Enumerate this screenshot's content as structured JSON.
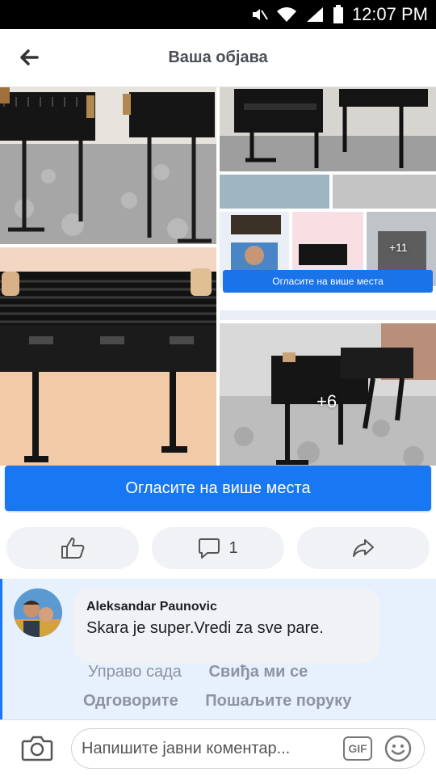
{
  "status_bar": {
    "time": "12:07 PM"
  },
  "header": {
    "title": "Ваша објава"
  },
  "photos": {
    "mini_cta_label": "Огласите на више места",
    "overlay_small": "+11",
    "overlay_large": "+6"
  },
  "cta": {
    "label": "Огласите на више места"
  },
  "actions": {
    "comment_count": "1"
  },
  "comment": {
    "author": "Aleksandar Paunovic",
    "text": "Skara je super.Vredi za sve pare.",
    "time": "Управо сада",
    "like": "Свиђа ми се",
    "reply": "Одговорите",
    "message": "Пошаљите поруку"
  },
  "composer": {
    "placeholder": "Напишите јавни коментар...",
    "gif": "GIF"
  },
  "colors": {
    "accent": "#1877f2",
    "comment_bg": "#e7f0fd"
  }
}
